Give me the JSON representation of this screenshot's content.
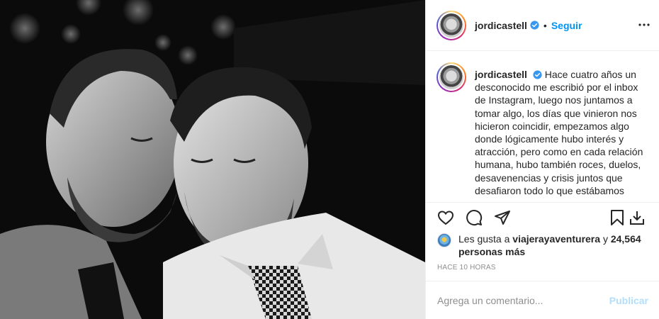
{
  "post": {
    "username": "jordicastell",
    "separator": "•",
    "follow_label": "Seguir",
    "caption": "Hace cuatro años un desconocido me escribió por el inbox de Instagram, luego nos juntamos a tomar algo, los días que vinieron nos hicieron coincidir, empezamos algo donde lógicamente hubo interés y atracción, pero como en cada relación humana, hubo también roces, duelos, desavenencias y crisis juntos que desafiaron todo lo que estábamos",
    "likes_prefix": "Les gusta a",
    "likes_user": "viajerayaventurera",
    "likes_connector": "y",
    "likes_count": "24,564 personas más",
    "time": "HACE 10 HORAS",
    "comment_placeholder": "Agrega un comentario...",
    "publish_label": "Publicar"
  },
  "icons": {
    "verified": "verified-badge-icon",
    "more": "more-options-icon",
    "like": "heart-icon",
    "comment": "comment-icon",
    "share": "share-icon",
    "save": "bookmark-icon",
    "download": "download-icon"
  },
  "colors": {
    "accent": "#0095f6",
    "publish_disabled": "#b2dffc",
    "muted": "#8e8e8e",
    "text": "#262626"
  }
}
